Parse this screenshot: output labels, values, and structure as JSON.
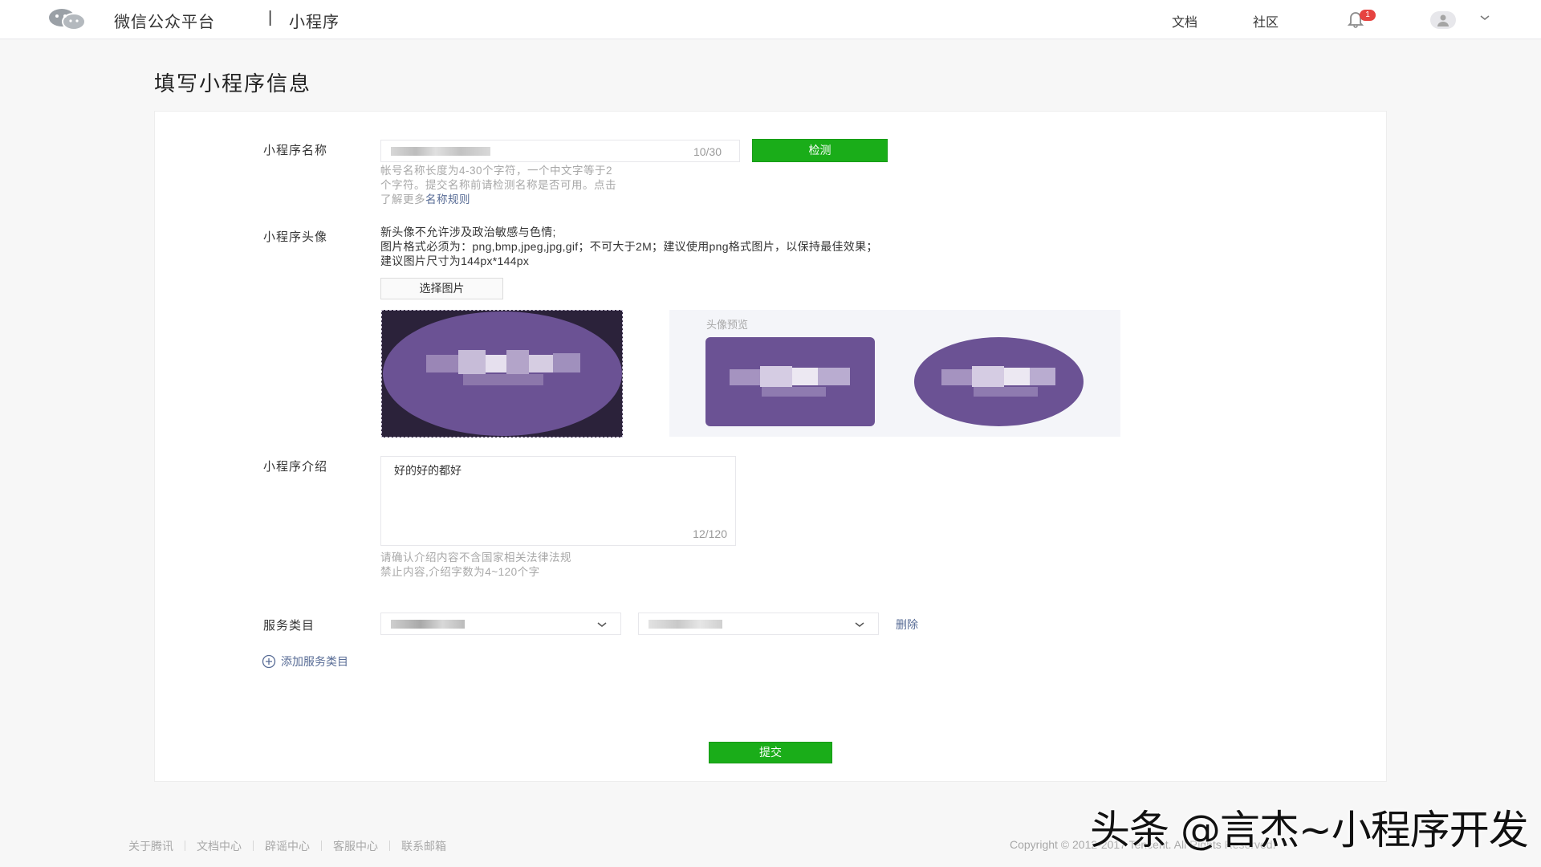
{
  "header": {
    "brand": "微信公众平台",
    "separator": "|",
    "sub_brand": "小程序",
    "nav_docs": "文档",
    "nav_community": "社区",
    "notification_count": "1"
  },
  "page": {
    "title": "填写小程序信息"
  },
  "form": {
    "name": {
      "label": "小程序名称",
      "count": "10/30",
      "check_button": "检测",
      "hint_lines": [
        "帐号名称长度为4-30个字符，一个中文字等于2",
        "个字符。提交名称前请检测名称是否可用。点击"
      ],
      "hint_prefix": "了解更多",
      "hint_link": "名称规则"
    },
    "avatar": {
      "label": "小程序头像",
      "rules": [
        "新头像不允许涉及政治敏感与色情;",
        "图片格式必须为：png,bmp,jpeg,jpg,gif；不可大于2M；建议使用png格式图片，以保持最佳效果；",
        "建议图片尺寸为144px*144px"
      ],
      "select_button": "选择图片",
      "preview_label": "头像预览"
    },
    "intro": {
      "label": "小程序介绍",
      "value": "好的好的都好",
      "count": "12/120",
      "hint_lines": [
        "请确认介绍内容不含国家相关法律法规",
        "禁止内容,介绍字数为4~120个字"
      ]
    },
    "category": {
      "label": "服务类目",
      "delete_link": "删除",
      "add_link": "添加服务类目"
    },
    "submit_button": "提交"
  },
  "footer": {
    "links": [
      "关于腾讯",
      "文档中心",
      "辟谣中心",
      "客服中心",
      "联系邮箱"
    ],
    "copyright": "Copyright © 2012-2017 Tencent. All Rights Reserved."
  },
  "watermark": "头条 @言杰~小程序开发",
  "colors": {
    "primary_green": "#1aad19",
    "link_blue": "#576b95",
    "avatar_purple": "#6b5294",
    "badge_red": "#e64340"
  }
}
